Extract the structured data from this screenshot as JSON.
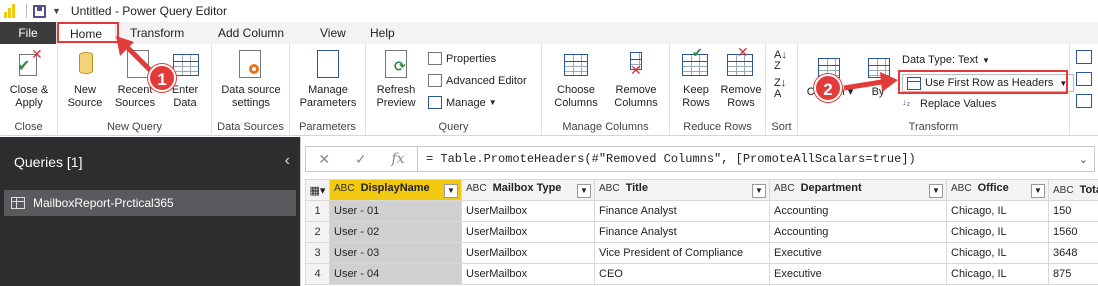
{
  "window": {
    "title": "Untitled - Power Query Editor"
  },
  "tabs": [
    "File",
    "Home",
    "Transform",
    "Add Column",
    "View",
    "Help"
  ],
  "ribbon": {
    "close_group": {
      "button": "Close &\nApply",
      "label": "Close"
    },
    "new_query": {
      "new_source": "New\nSource",
      "recent_sources": "Recent\nSources",
      "enter_data": "Enter\nData",
      "label": "New Query"
    },
    "data_sources": {
      "settings": "Data source\nsettings",
      "label": "Data Sources"
    },
    "parameters": {
      "manage": "Manage\nParameters",
      "label": "Parameters"
    },
    "query": {
      "refresh": "Refresh\nPreview",
      "properties": "Properties",
      "advanced_editor": "Advanced Editor",
      "manage": "Manage",
      "label": "Query"
    },
    "manage_columns": {
      "choose": "Choose\nColumns",
      "remove": "Remove\nColumns",
      "label": "Manage Columns"
    },
    "reduce_rows": {
      "keep": "Keep\nRows",
      "remove": "Remove\nRows",
      "label": "Reduce Rows"
    },
    "sort": {
      "label": "Sort"
    },
    "transform": {
      "split_column": "Column",
      "group_by": "By",
      "data_type": "Data Type: Text",
      "use_first_row": "Use First Row as Headers",
      "replace_values": "Replace Values",
      "label": "Transform"
    }
  },
  "callouts": [
    "1",
    "2"
  ],
  "queries_pane": {
    "heading": "Queries [1]",
    "items": [
      "MailboxReport-Prctical365"
    ]
  },
  "formula_bar": {
    "formula": "= Table.PromoteHeaders(#\"Removed Columns\", [PromoteAllScalars=true])"
  },
  "table": {
    "columns": [
      "DisplayName",
      "Mailbox Type",
      "Title",
      "Department",
      "Office",
      "Total"
    ],
    "type_label": "ABC",
    "rows": [
      [
        "1",
        "User - 01",
        "UserMailbox",
        "Finance Analyst",
        "Accounting",
        "Chicago, IL",
        "150"
      ],
      [
        "2",
        "User - 02",
        "UserMailbox",
        "Finance Analyst",
        "Accounting",
        "Chicago, IL",
        "1560"
      ],
      [
        "3",
        "User - 03",
        "UserMailbox",
        "Vice President of Compliance",
        "Executive",
        "Chicago, IL",
        "3648"
      ],
      [
        "4",
        "User - 04",
        "UserMailbox",
        "CEO",
        "Executive",
        "Chicago, IL",
        "875"
      ]
    ]
  },
  "colors": {
    "accent": "#f2c811",
    "callout": "#e33a3a",
    "dark_pane": "#2d2d30"
  }
}
